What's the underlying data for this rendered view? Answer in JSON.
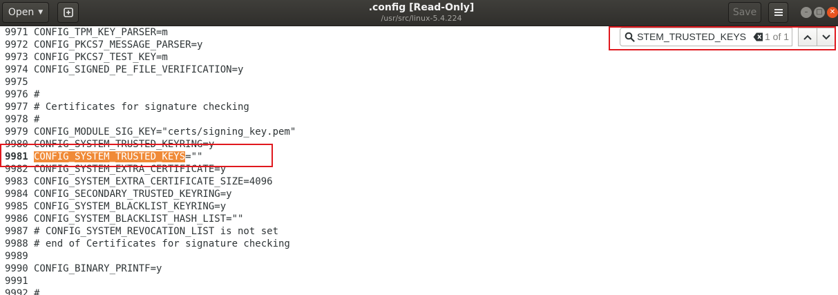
{
  "header": {
    "open_label": "Open",
    "save_label": "Save",
    "title": ".config [Read-Only]",
    "subtitle": "/usr/src/linux-5.4.224"
  },
  "window_controls": {
    "minimize": "minimize-icon",
    "maximize": "maximize-icon",
    "close": "close-icon"
  },
  "search": {
    "query": "CONFIG_SYSTEM_TRUSTED_KEYS",
    "match_count": "1 of 1"
  },
  "editor": {
    "current_line": "9981",
    "highlight_match": "CONFIG_SYSTEM_TRUSTED_KEYS",
    "lines": [
      {
        "num": "9971",
        "text": "CONFIG_TPM_KEY_PARSER=m"
      },
      {
        "num": "9972",
        "text": "CONFIG_PKCS7_MESSAGE_PARSER=y"
      },
      {
        "num": "9973",
        "text": "CONFIG_PKCS7_TEST_KEY=m"
      },
      {
        "num": "9974",
        "text": "CONFIG_SIGNED_PE_FILE_VERIFICATION=y"
      },
      {
        "num": "9975",
        "text": ""
      },
      {
        "num": "9976",
        "text": "#"
      },
      {
        "num": "9977",
        "text": "# Certificates for signature checking"
      },
      {
        "num": "9978",
        "text": "#"
      },
      {
        "num": "9979",
        "text": "CONFIG_MODULE_SIG_KEY=\"certs/signing_key.pem\""
      },
      {
        "num": "9980",
        "text": "CONFIG_SYSTEM_TRUSTED_KEYRING=y"
      },
      {
        "num": "9981",
        "text": "=\"\""
      },
      {
        "num": "9982",
        "text": "CONFIG_SYSTEM_EXTRA_CERTIFICATE=y"
      },
      {
        "num": "9983",
        "text": "CONFIG_SYSTEM_EXTRA_CERTIFICATE_SIZE=4096"
      },
      {
        "num": "9984",
        "text": "CONFIG_SECONDARY_TRUSTED_KEYRING=y"
      },
      {
        "num": "9985",
        "text": "CONFIG_SYSTEM_BLACKLIST_KEYRING=y"
      },
      {
        "num": "9986",
        "text": "CONFIG_SYSTEM_BLACKLIST_HASH_LIST=\"\""
      },
      {
        "num": "9987",
        "text": "# CONFIG_SYSTEM_REVOCATION_LIST is not set"
      },
      {
        "num": "9988",
        "text": "# end of Certificates for signature checking"
      },
      {
        "num": "9989",
        "text": ""
      },
      {
        "num": "9990",
        "text": "CONFIG_BINARY_PRINTF=y"
      },
      {
        "num": "9991",
        "text": ""
      },
      {
        "num": "9992",
        "text": "#"
      }
    ]
  },
  "colors": {
    "headerbar": "#3a3935",
    "highlight": "#f08a37",
    "annotation": "#e0181e",
    "close_button": "#e95420"
  }
}
